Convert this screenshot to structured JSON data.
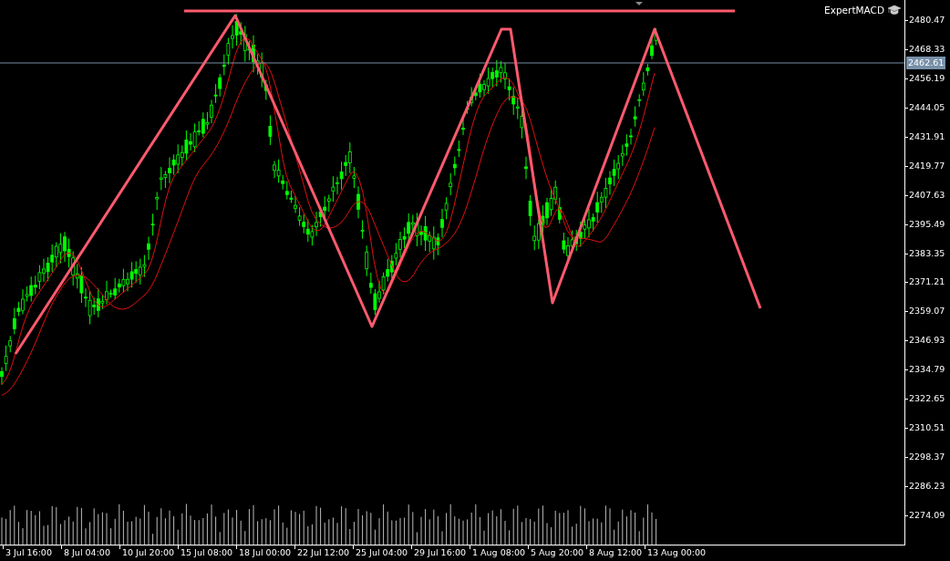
{
  "expert": {
    "name": "ExpertMACD"
  },
  "price_axis": {
    "labels": [
      "2480.47",
      "2468.33",
      "2456.19",
      "2444.05",
      "2431.91",
      "2419.77",
      "2407.63",
      "2395.49",
      "2383.35",
      "2371.21",
      "2359.07",
      "2346.93",
      "2334.79",
      "2322.65",
      "2310.51",
      "2298.37",
      "2286.23",
      "2274.09"
    ],
    "current_price": "2462.61"
  },
  "time_axis": {
    "labels": [
      "3 Jul 16:00",
      "8 Jul 04:00",
      "10 Jul 20:00",
      "15 Jul 08:00",
      "18 Jul 00:00",
      "22 Jul 12:00",
      "25 Jul 04:00",
      "29 Jul 16:00",
      "1 Aug 08:00",
      "5 Aug 20:00",
      "8 Aug 12:00",
      "13 Aug 00:00"
    ]
  }
}
